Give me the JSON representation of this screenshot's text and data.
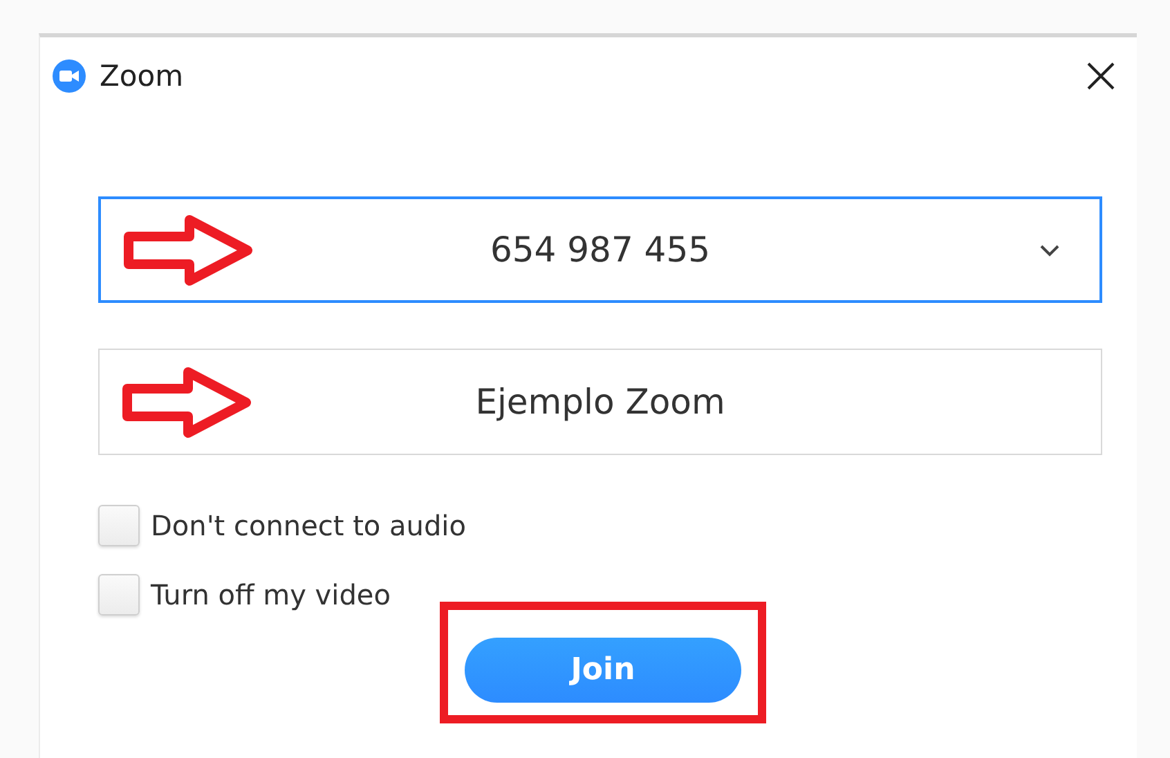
{
  "window": {
    "title": "Zoom"
  },
  "fields": [
    {
      "kind": "dropdown",
      "value": "654 987 455",
      "focused": true,
      "arrow": true
    },
    {
      "kind": "text",
      "value": "Ejemplo Zoom",
      "focused": false,
      "arrow": true
    }
  ],
  "options": [
    {
      "label": "Don't connect to audio",
      "checked": false
    },
    {
      "label": "Turn off my video",
      "checked": false
    }
  ],
  "join_button": {
    "label": "Join",
    "highlighted": true
  }
}
